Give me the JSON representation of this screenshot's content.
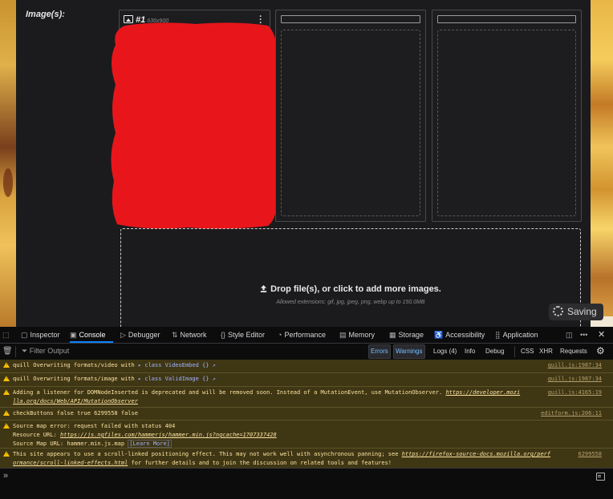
{
  "page": {
    "images_label": "Image(s):",
    "card1": {
      "index": "#1",
      "dims": "636x900"
    },
    "drop_label": "Drop file(s), or click to add more images.",
    "allowed_extensions": "Allowed extensions: gif, jpg, jpeg, png, webp up to 150.0MB",
    "saving_label": "Saving"
  },
  "devtools": {
    "tabs": [
      {
        "label": "Inspector",
        "icon": "inspector-icon"
      },
      {
        "label": "Console",
        "icon": "console-icon",
        "selected": true
      },
      {
        "label": "Debugger",
        "icon": "debugger-icon"
      },
      {
        "label": "Network",
        "icon": "network-icon"
      },
      {
        "label": "Style Editor",
        "icon": "style-editor-icon"
      },
      {
        "label": "Performance",
        "icon": "performance-icon"
      },
      {
        "label": "Memory",
        "icon": "memory-icon"
      },
      {
        "label": "Storage",
        "icon": "storage-icon"
      },
      {
        "label": "Accessibility",
        "icon": "accessibility-icon"
      },
      {
        "label": "Application",
        "icon": "application-icon"
      }
    ],
    "filter_placeholder": "Filter Output",
    "filters": [
      {
        "label": "Errors",
        "active": true
      },
      {
        "label": "Warnings",
        "active": true
      },
      {
        "label": "Logs (4)",
        "active": false
      },
      {
        "label": "Info",
        "active": false
      },
      {
        "label": "Debug",
        "active": false
      },
      {
        "label": "CSS",
        "active": false
      },
      {
        "label": "XHR",
        "active": false
      },
      {
        "label": "Requests",
        "active": false
      }
    ],
    "messages": [
      {
        "text": "quill Overwriting formats/video with",
        "obj": "▸ class VideoEmbed {} ↗",
        "source": "quill.js:1987:34"
      },
      {
        "text": "quill Overwriting formats/image with",
        "obj": "▸ class ValidImage {} ↗",
        "source": "quill.js:1987:34"
      },
      {
        "line1": "Adding a listener for DOMNodeInserted is deprecated and will be removed soon. Instead of a MutationEvent, use MutationObserver. ",
        "link1": "https://developer.mozi",
        "line2_link": "lla.org/docs/Web/API/MutationObserver",
        "source": "quill.js:4165:19"
      },
      {
        "text": "checkButtons false true 6299558 false",
        "source": "editform.js:206:11"
      },
      {
        "line1": "Source map error: request failed with status 404",
        "line2": "Resource URL: ",
        "line2_link": "https://js.ngfiles.com/hammerjs/hammer.min.js?ngcache=1707337428",
        "line3": "Source Map URL: hammer.min.js.map ",
        "learn_more": "[Learn More]"
      },
      {
        "line1": "This site appears to use a scroll-linked positioning effect. This may not work well with asynchronous panning; see ",
        "link1": "https://firefox-source-docs.mozilla.org/perf",
        "line2_link": "ormance/scroll-linked-effects.html",
        "line2": " for further details and to join the discussion on related tools and features!",
        "source": "6299558"
      }
    ],
    "prompt": "»"
  },
  "colors": {
    "warning_bg": "#3f3614",
    "warning_text": "#fce2a1",
    "accent": "#0a84ff",
    "redaction": "#e8161b"
  }
}
